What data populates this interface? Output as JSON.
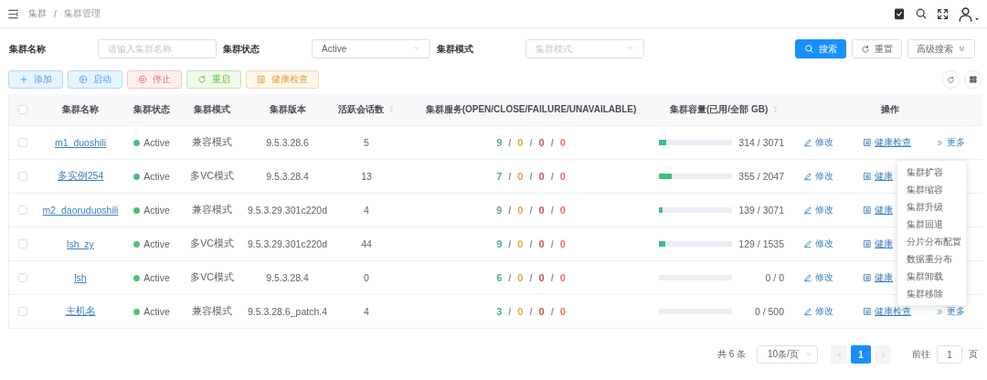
{
  "header": {
    "breadcrumb": [
      "集群",
      "集群管理"
    ],
    "separator": "/"
  },
  "filters": [
    {
      "label": "集群名称",
      "kind": "input",
      "placeholder": "请输入集群名称"
    },
    {
      "label": "集群状态",
      "kind": "select",
      "value": "Active"
    },
    {
      "label": "集群模式",
      "kind": "select",
      "placeholder": "集群模式"
    }
  ],
  "search_buttons": [
    {
      "label": "搜索",
      "kind": "primary"
    },
    {
      "label": "重置",
      "kind": "reset"
    },
    {
      "label": "高级搜索",
      "kind": "advanced"
    }
  ],
  "toolbar": [
    {
      "label": "添加",
      "kind": "add"
    },
    {
      "label": "启动",
      "kind": "start"
    },
    {
      "label": "停止",
      "kind": "stop"
    },
    {
      "label": "重启",
      "kind": "restart"
    },
    {
      "label": "健康检查",
      "kind": "health"
    }
  ],
  "table": {
    "select_all_checked": false,
    "service_separator": "/",
    "columns": [
      {
        "label": "集群名称",
        "sortable": false
      },
      {
        "label": "集群状态",
        "sortable": false
      },
      {
        "label": "集群模式",
        "sortable": false
      },
      {
        "label": "集群版本",
        "sortable": false
      },
      {
        "label": "活跃会话数",
        "sortable": true
      },
      {
        "label": "集群服务(OPEN/CLOSE/FAILURE/UNAVAILABLE)",
        "sortable": false
      },
      {
        "label": "集群容量(已用/全部 GB)",
        "sortable": true
      },
      {
        "label": "操作",
        "sortable": false
      }
    ],
    "rows": [
      {
        "checked": false,
        "name": "m1_duoshili",
        "status": {
          "text": "Active",
          "color": "#4cc17f"
        },
        "mode": "兼容模式",
        "version": "9.5.3.28.6",
        "sessions": "5",
        "services": [
          {
            "text": "9",
            "color": "#4cae8a"
          },
          {
            "text": "0",
            "color": "#e6a23c"
          },
          {
            "text": "0",
            "color": "#c45656"
          },
          {
            "text": "0",
            "color": "#f56c6c"
          }
        ],
        "capacity": {
          "level": 0.102,
          "text": "314 / 3071"
        },
        "actions": [
          {
            "kind": "edit",
            "label": "修改"
          },
          {
            "kind": "health",
            "label": "健康检查"
          },
          {
            "kind": "more",
            "label": "更多"
          }
        ]
      },
      {
        "checked": false,
        "name": "多实例254",
        "status": {
          "text": "Active",
          "color": "#4cc17f"
        },
        "mode": "多VC模式",
        "version": "9.5.3.28.4",
        "sessions": "13",
        "services": [
          {
            "text": "7",
            "color": "#4cae8a"
          },
          {
            "text": "0",
            "color": "#e6a23c"
          },
          {
            "text": "0",
            "color": "#c45656"
          },
          {
            "text": "0",
            "color": "#f56c6c"
          }
        ],
        "capacity": {
          "level": 0.173,
          "text": "355 / 2047"
        },
        "actions": [
          {
            "kind": "edit",
            "label": "修改"
          },
          {
            "kind": "health",
            "label": "健康"
          }
        ]
      },
      {
        "checked": false,
        "name": "m2_daoruduoshili",
        "status": {
          "text": "Active",
          "color": "#4cc17f"
        },
        "mode": "兼容模式",
        "version": "9.5.3.29.301c220d",
        "sessions": "4",
        "services": [
          {
            "text": "9",
            "color": "#4cae8a"
          },
          {
            "text": "0",
            "color": "#e6a23c"
          },
          {
            "text": "0",
            "color": "#c45656"
          },
          {
            "text": "0",
            "color": "#f56c6c"
          }
        ],
        "capacity": {
          "level": 0.045,
          "text": "139 / 3071"
        },
        "actions": [
          {
            "kind": "edit",
            "label": "修改"
          },
          {
            "kind": "health",
            "label": "健康"
          }
        ]
      },
      {
        "checked": false,
        "name": "lsh_zy",
        "status": {
          "text": "Active",
          "color": "#4cc17f"
        },
        "mode": "多VC模式",
        "version": "9.5.3.29.301c220d",
        "sessions": "44",
        "services": [
          {
            "text": "9",
            "color": "#4cae8a"
          },
          {
            "text": "0",
            "color": "#e6a23c"
          },
          {
            "text": "0",
            "color": "#c45656"
          },
          {
            "text": "0",
            "color": "#f56c6c"
          }
        ],
        "capacity": {
          "level": 0.084,
          "text": "129 / 1535"
        },
        "actions": [
          {
            "kind": "edit",
            "label": "修改"
          },
          {
            "kind": "health",
            "label": "健康"
          }
        ]
      },
      {
        "checked": false,
        "name": "lsh",
        "status": {
          "text": "Active",
          "color": "#4cc17f"
        },
        "mode": "多VC模式",
        "version": "9.5.3.28.4",
        "sessions": "0",
        "services": [
          {
            "text": "6",
            "color": "#4cae8a"
          },
          {
            "text": "0",
            "color": "#e6a23c"
          },
          {
            "text": "0",
            "color": "#c45656"
          },
          {
            "text": "0",
            "color": "#f56c6c"
          }
        ],
        "capacity": {
          "level": 0,
          "text": "0 / 0"
        },
        "actions": [
          {
            "kind": "edit",
            "label": "修改"
          },
          {
            "kind": "health",
            "label": "健康"
          }
        ]
      },
      {
        "checked": false,
        "name": "主机名",
        "status": {
          "text": "Active",
          "color": "#4cc17f"
        },
        "mode": "兼容模式",
        "version": "9.5.3.28.6_patch.4",
        "sessions": "4",
        "services": [
          {
            "text": "3",
            "color": "#4cae8a"
          },
          {
            "text": "0",
            "color": "#e6a23c"
          },
          {
            "text": "0",
            "color": "#c45656"
          },
          {
            "text": "0",
            "color": "#f56c6c"
          }
        ],
        "capacity": {
          "level": 0,
          "text": "0 / 500"
        },
        "actions": [
          {
            "kind": "edit",
            "label": "修改"
          },
          {
            "kind": "health",
            "label": "健康检查"
          },
          {
            "kind": "more",
            "label": "更多"
          }
        ]
      }
    ]
  },
  "dropdown": {
    "items": [
      "集群扩容",
      "集群缩容",
      "集群升级",
      "集群回退",
      "分片分布配置",
      "数据重分布",
      "集群卸载",
      "集群移除"
    ]
  },
  "pagination": {
    "total": "共 6 条",
    "page_size": "10条/页",
    "pages": [
      {
        "label": "1",
        "selected": true
      }
    ],
    "goto_label": "前往",
    "goto_value": "1",
    "goto_suffix": "页"
  }
}
